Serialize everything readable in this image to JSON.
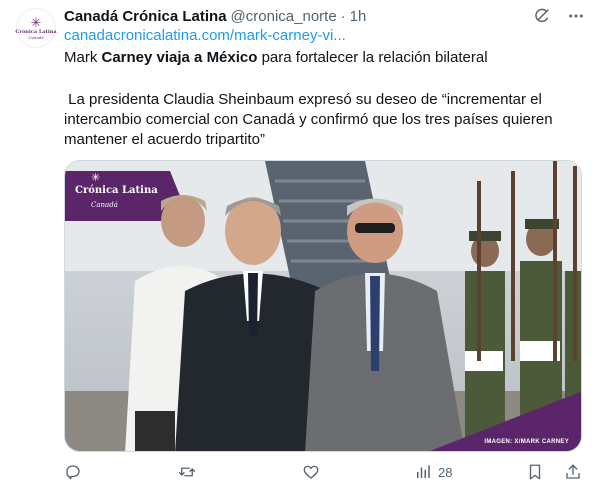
{
  "account": {
    "display_name": "Canadá Crónica Latina",
    "handle": "@cronica_norte",
    "separator": "·",
    "time": "1h",
    "avatar_text": "Crónica Latina",
    "avatar_sub": "Canadá"
  },
  "tweet": {
    "link": "canadacronicalatina.com/mark-carney-vi...",
    "line1": {
      "p1": "Mark ",
      "b1": "Carney viaja a México",
      "p2": " para fortalecer la relación bilateral"
    },
    "paragraph2": " La presidenta Claudia Sheinbaum expresó su deseo de “incrementar el intercambio comercial con Canadá y confirmó que los tres países quieren mantener el acuerdo tripartito”"
  },
  "media": {
    "logo_title": "Crónica Latina",
    "logo_sub": "Canadá",
    "credit": "IMAGEN: X/MARK CARNEY"
  },
  "actions": {
    "views_count": "28"
  },
  "icons": {
    "grok": "grok-icon",
    "more": "more-icon",
    "reply": "reply-icon",
    "retweet": "retweet-icon",
    "like": "like-icon",
    "views": "views-icon",
    "bookmark": "bookmark-icon",
    "share": "share-icon"
  },
  "colors": {
    "link": "#1d9bf0",
    "muted": "#536471",
    "brand_purple": "#6b2c7a"
  }
}
